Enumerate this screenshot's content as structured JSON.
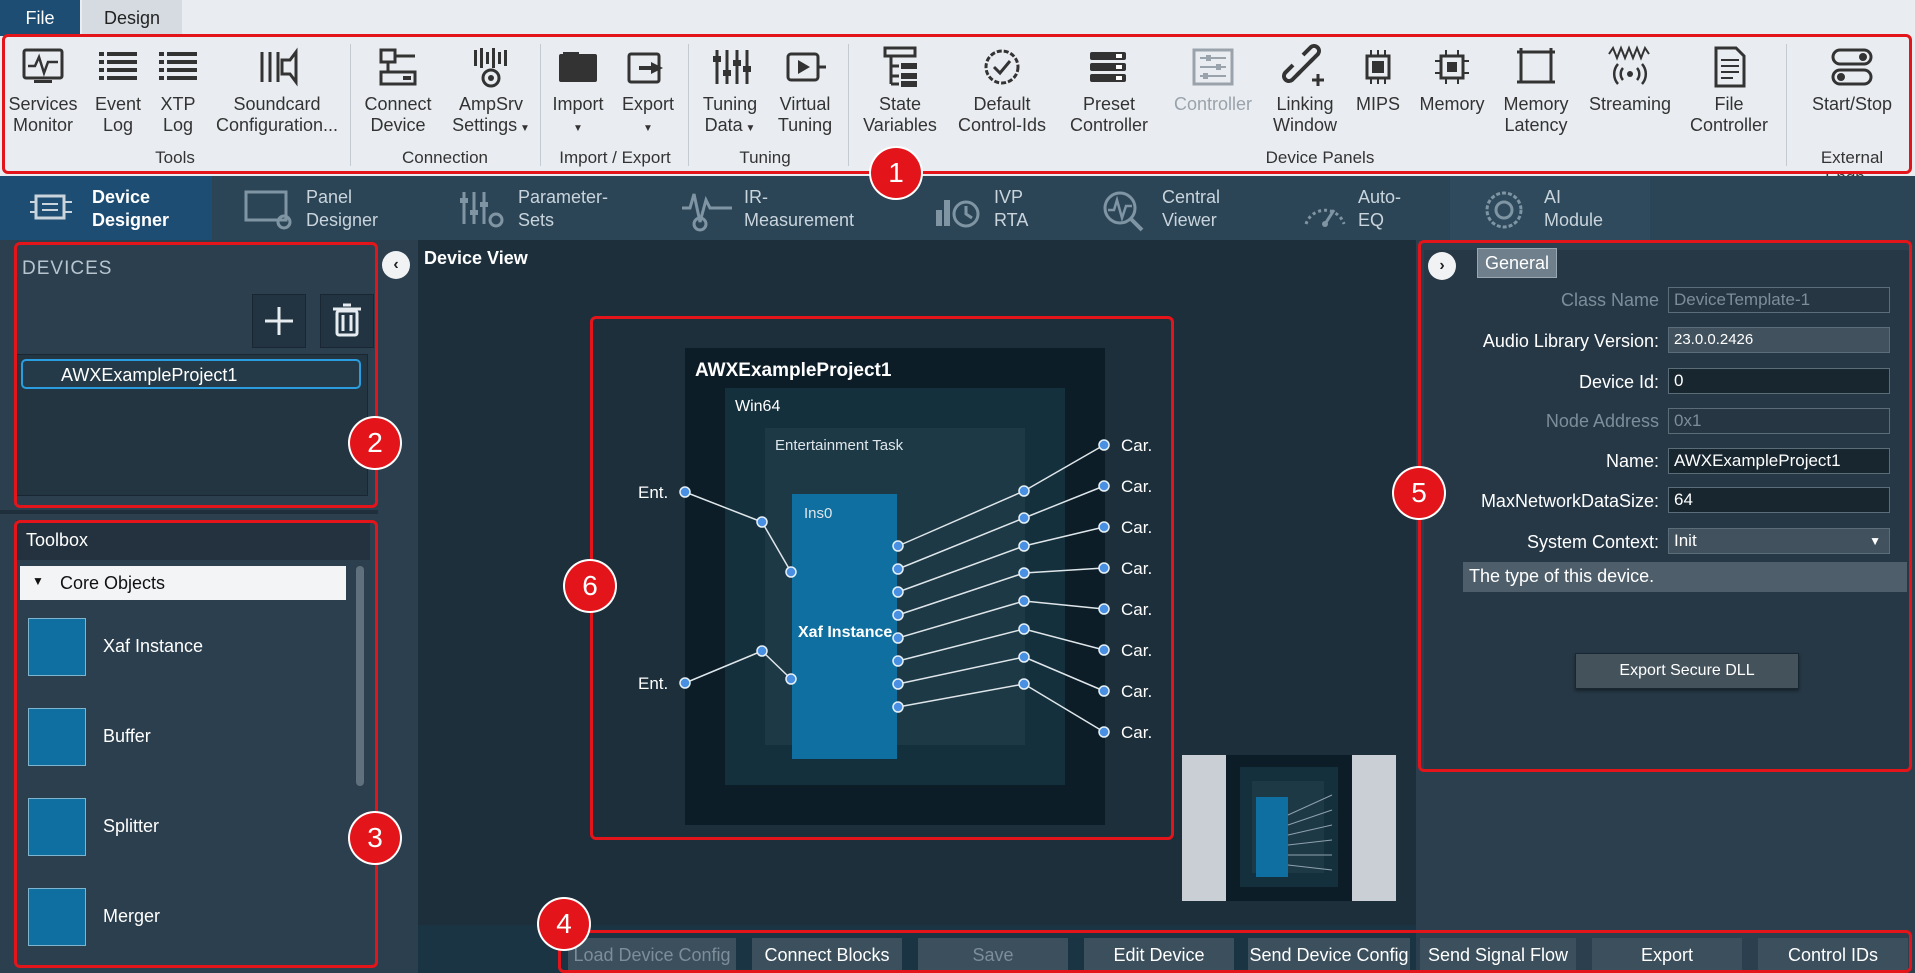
{
  "menu": {
    "file": "File",
    "design": "Design"
  },
  "ribbon": {
    "groups": {
      "tools": "Tools",
      "connection": "Connection",
      "import_export": "Import / Export",
      "tuning": "Tuning",
      "device_panels": "Device Panels",
      "external": "External Endp..."
    },
    "buttons": {
      "services_monitor": [
        "Services",
        "Monitor"
      ],
      "event_log": [
        "Event",
        "Log"
      ],
      "xtp_log": [
        "XTP",
        "Log"
      ],
      "soundcard": [
        "Soundcard",
        "Configuration..."
      ],
      "connect_device": [
        "Connect",
        "Device"
      ],
      "ampsrv": [
        "AmpSrv",
        "Settings"
      ],
      "import": "Import",
      "export": "Export",
      "tuning_data": [
        "Tuning",
        "Data"
      ],
      "virtual_tuning": [
        "Virtual",
        "Tuning"
      ],
      "state_variables": [
        "State",
        "Variables"
      ],
      "default_control_ids": [
        "Default",
        "Control-Ids"
      ],
      "preset_controller": [
        "Preset",
        "Controller"
      ],
      "controller": "Controller",
      "linking_window": [
        "Linking",
        "Window"
      ],
      "mips": "MIPS",
      "memory": "Memory",
      "memory_latency": [
        "Memory",
        "Latency"
      ],
      "streaming": "Streaming",
      "file_controller": [
        "File",
        "Controller"
      ],
      "start_stop": "Start/Stop"
    }
  },
  "module_tabs": [
    [
      "Device",
      "Designer"
    ],
    [
      "Panel",
      "Designer"
    ],
    [
      "Parameter-",
      "Sets"
    ],
    [
      "IR-",
      "Measurement"
    ],
    [
      "IVP",
      "RTA"
    ],
    [
      "Central",
      "Viewer"
    ],
    [
      "Auto-",
      "EQ"
    ],
    [
      "AI",
      "Module"
    ]
  ],
  "devices": {
    "title": "DEVICES",
    "items": [
      "AWXExampleProject1"
    ]
  },
  "toolbox": {
    "title": "Toolbox",
    "category": "Core Objects",
    "items": [
      "Xaf Instance",
      "Buffer",
      "Splitter",
      "Merger"
    ]
  },
  "device_view": {
    "title": "Device View",
    "project": "AWXExampleProject1",
    "platform": "Win64",
    "task": "Entertainment Task",
    "instance_id": "Ins0",
    "instance_name": "Xaf Instance",
    "inputs": [
      "Ent.",
      "Ent."
    ],
    "outputs": [
      "Car.",
      "Car.",
      "Car.",
      "Car.",
      "Car.",
      "Car.",
      "Car.",
      "Car."
    ]
  },
  "properties": {
    "tab": "General",
    "fields": [
      {
        "label": "Class Name",
        "value": "DeviceTemplate-1",
        "disabled": true
      },
      {
        "label": "Audio Library Version:",
        "value": "23.0.0.2426",
        "disabled": false
      },
      {
        "label": "Device Id:",
        "value": "0",
        "disabled": false
      },
      {
        "label": "Node Address",
        "value": "0x1",
        "disabled": true
      },
      {
        "label": "Name:",
        "value": "AWXExampleProject1",
        "disabled": false
      },
      {
        "label": "MaxNetworkDataSize:",
        "value": "64",
        "disabled": false
      },
      {
        "label": "System Context:",
        "value": "Init",
        "disabled": false
      }
    ],
    "description": "The type of this device.",
    "export_button": "Export Secure DLL"
  },
  "bottom_buttons": [
    {
      "label": "Load Device Config",
      "disabled": true
    },
    {
      "label": "Connect Blocks",
      "disabled": false
    },
    {
      "label": "Save",
      "disabled": true
    },
    {
      "label": "Edit Device",
      "disabled": false
    },
    {
      "label": "Send Device Config",
      "disabled": false
    },
    {
      "label": "Send Signal Flow",
      "disabled": false
    },
    {
      "label": "Export",
      "disabled": false
    },
    {
      "label": "Control IDs",
      "disabled": false
    }
  ],
  "callouts": [
    "1",
    "2",
    "3",
    "4",
    "5",
    "6"
  ],
  "colors": {
    "accent": "#1d4d72",
    "callout": "#e3151b",
    "block": "#0e6fa0",
    "port": "#4a90e2"
  }
}
